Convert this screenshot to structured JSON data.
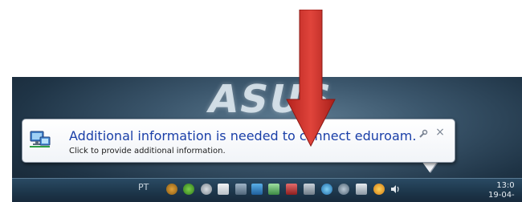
{
  "notification": {
    "title": "Additional information is needed to connect eduroam.",
    "subtitle": "Click to provide additional information.",
    "icon": "network-connection-icon",
    "close_glyph": "×"
  },
  "wallpaper": {
    "logo_text": "ASUS"
  },
  "taskbar": {
    "language": "PT",
    "tray_icons": [
      "app-icon",
      "leaf-icon",
      "gear-icon",
      "window-icon",
      "chat-icon",
      "network-share-icon",
      "shield-icon",
      "security-icon",
      "keyboard-icon",
      "globe-icon",
      "link-icon",
      "monitor-icon",
      "wireless-network-icon",
      "volume-icon"
    ],
    "clock_time": "13:0",
    "clock_date": "19-04-"
  },
  "colors": {
    "arrow": "#d4312a",
    "title": "#1a3fa8",
    "taskbar": "#1c3549"
  }
}
